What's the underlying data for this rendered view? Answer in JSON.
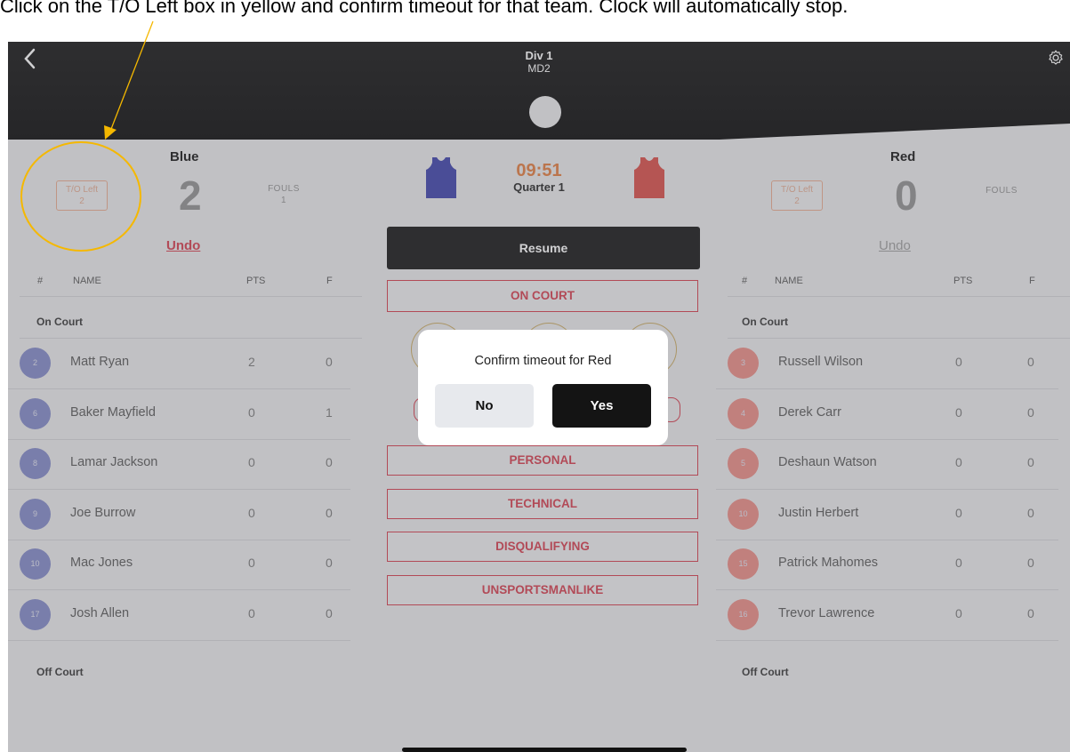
{
  "annotation": {
    "caption": "Click on the T/O Left box in yellow and confirm timeout for that team. Clock will automatically stop."
  },
  "header": {
    "title": "Div 1",
    "subtitle": "MD2",
    "back_icon": "chevron-left-icon",
    "settings_icon": "gear-icon"
  },
  "clock": {
    "time": "09:51",
    "period": "Quarter 1"
  },
  "resume_label": "Resume",
  "teams": {
    "blue": {
      "name": "Blue",
      "color": "#3a3ea8",
      "timeouts_label": "T/O Left",
      "timeouts_left": "2",
      "score": "2",
      "fouls_label": "FOULS",
      "fouls": "1",
      "undo": "Undo",
      "columns": {
        "num": "#",
        "name": "NAME",
        "pts": "PTS",
        "f": "F"
      },
      "on_court_label": "On Court",
      "off_court_label": "Off Court",
      "players": [
        {
          "num": "2",
          "name": "Matt Ryan",
          "pts": "2",
          "f": "0"
        },
        {
          "num": "6",
          "name": "Baker Mayfield",
          "pts": "0",
          "f": "1"
        },
        {
          "num": "8",
          "name": "Lamar Jackson",
          "pts": "0",
          "f": "0"
        },
        {
          "num": "9",
          "name": "Joe Burrow",
          "pts": "0",
          "f": "0"
        },
        {
          "num": "10",
          "name": "Mac Jones",
          "pts": "0",
          "f": "0"
        },
        {
          "num": "17",
          "name": "Josh Allen",
          "pts": "0",
          "f": "0"
        }
      ]
    },
    "red": {
      "name": "Red",
      "color": "#d84a45",
      "timeouts_label": "T/O Left",
      "timeouts_left": "2",
      "score": "0",
      "fouls_label": "FOULS",
      "undo": "Undo",
      "columns": {
        "num": "#",
        "name": "NAME",
        "pts": "PTS",
        "f": "F"
      },
      "on_court_label": "On Court",
      "off_court_label": "Off Court",
      "players": [
        {
          "num": "3",
          "name": "Russell Wilson",
          "pts": "0",
          "f": "0"
        },
        {
          "num": "4",
          "name": "Derek Carr",
          "pts": "0",
          "f": "0"
        },
        {
          "num": "5",
          "name": "Deshaun Watson",
          "pts": "0",
          "f": "0"
        },
        {
          "num": "10",
          "name": "Justin Herbert",
          "pts": "0",
          "f": "0"
        },
        {
          "num": "15",
          "name": "Patrick Mahomes",
          "pts": "0",
          "f": "0"
        },
        {
          "num": "16",
          "name": "Trevor Lawrence",
          "pts": "0",
          "f": "0"
        }
      ]
    }
  },
  "center_buttons": {
    "on_court": "ON COURT",
    "personal": "PERSONAL",
    "technical": "TECHNICAL",
    "disqualifying": "DISQUALIFYING",
    "unsportsmanlike": "UNSPORTSMANLIKE"
  },
  "dialog": {
    "message": "Confirm timeout for Red",
    "no": "No",
    "yes": "Yes"
  },
  "colors": {
    "accent_red": "#d33a4b",
    "clock_orange": "#e07a3c",
    "highlight_yellow": "#f5b800"
  }
}
